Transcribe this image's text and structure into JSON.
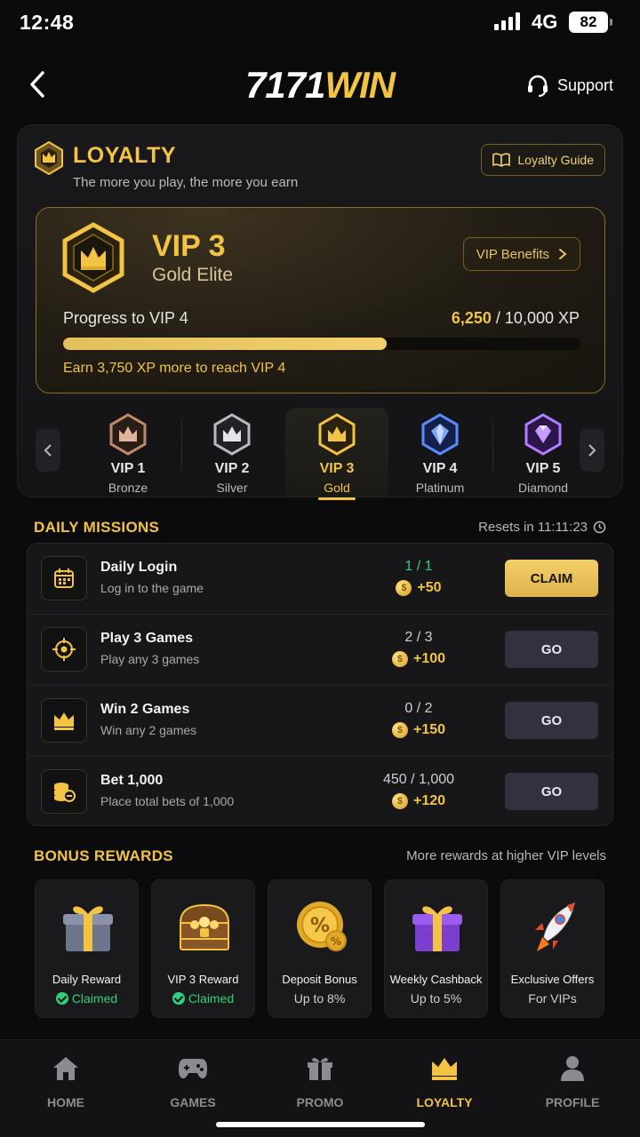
{
  "status": {
    "time": "12:48",
    "network": "4G",
    "battery": "82"
  },
  "header": {
    "logo_a": "7171",
    "logo_b": "WIN",
    "support_label": "Support"
  },
  "loyalty": {
    "title": "LOYALTY",
    "subtitle": "The more you play, the more you earn",
    "guide_label": "Loyalty Guide",
    "current": {
      "level": "VIP 3",
      "tier": "Gold Elite",
      "benefits_label": "VIP Benefits",
      "progress_label": "Progress to VIP 4",
      "xp_current": "6,250",
      "xp_sep": " / ",
      "xp_target": "10,000 XP",
      "progress_fraction": 0.625,
      "note": "Earn 3,750 XP more to reach VIP 4"
    },
    "tiers": [
      {
        "name": "VIP 1",
        "sub": "Bronze",
        "color": "#c08a6a"
      },
      {
        "name": "VIP 2",
        "sub": "Silver",
        "color": "#b9b9c0"
      },
      {
        "name": "VIP 3",
        "sub": "Gold",
        "color": "#f3c344"
      },
      {
        "name": "VIP 4",
        "sub": "Platinum",
        "color": "#5a8cff"
      },
      {
        "name": "VIP 5",
        "sub": "Diamond",
        "color": "#b47cff"
      }
    ]
  },
  "missions": {
    "title": "DAILY MISSIONS",
    "reset": "Resets in 11:11:23",
    "items": [
      {
        "title": "Daily Login",
        "desc": "Log in to the game",
        "progress": "1 / 1",
        "reward": "+50",
        "button": "CLAIM",
        "icon": "calendar-icon"
      },
      {
        "title": "Play 3 Games",
        "desc": "Play any 3 games",
        "progress": "2 / 3",
        "reward": "+100",
        "button": "GO",
        "icon": "target-icon"
      },
      {
        "title": "Win 2 Games",
        "desc": "Win any 2 games",
        "progress": "0 / 2",
        "reward": "+150",
        "button": "GO",
        "icon": "crown-icon"
      },
      {
        "title": "Bet 1,000",
        "desc": "Place total bets of 1,000",
        "progress": "450 / 1,000",
        "reward": "+120",
        "button": "GO",
        "icon": "coins-icon"
      }
    ]
  },
  "rewards": {
    "title": "BONUS REWARDS",
    "note": "More rewards at higher VIP levels",
    "items": [
      {
        "name": "Daily Reward",
        "sub": "Claimed",
        "icon": "gift-icon"
      },
      {
        "name": "VIP 3 Reward",
        "sub": "Claimed",
        "icon": "treasure-chest-icon"
      },
      {
        "name": "Deposit Bonus",
        "sub": "Up to 8%",
        "icon": "percent-coin-icon"
      },
      {
        "name": "Weekly Cashback",
        "sub": "Up to 5%",
        "icon": "purple-gift-icon"
      },
      {
        "name": "Exclusive Offers",
        "sub": "For VIPs",
        "icon": "rocket-icon"
      }
    ]
  },
  "nav": [
    {
      "label": "HOME",
      "icon": "home-icon"
    },
    {
      "label": "GAMES",
      "icon": "gamepad-icon"
    },
    {
      "label": "PROMO",
      "icon": "gift-icon"
    },
    {
      "label": "LOYALTY",
      "icon": "crown-icon"
    },
    {
      "label": "PROFILE",
      "icon": "user-icon"
    }
  ],
  "colors": {
    "accent": "#f3c344",
    "success": "#2fd07a",
    "background": "#0b0b0c"
  }
}
